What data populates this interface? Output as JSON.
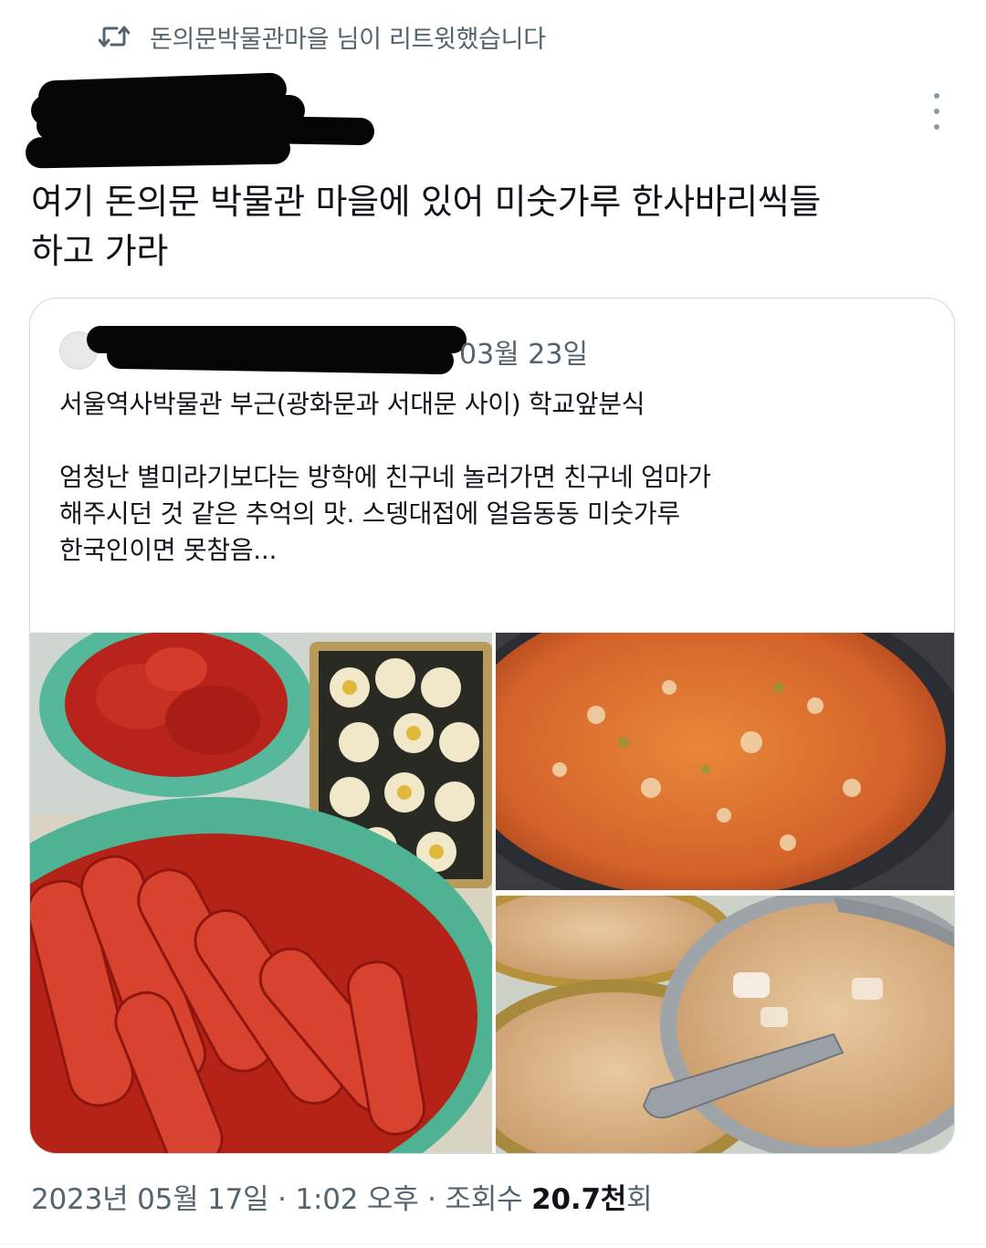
{
  "retweet_banner": {
    "text": "돈의문박물관마을 님이 리트윗했습니다"
  },
  "tweet": {
    "text": "여기 돈의문 박물관 마을에 있어 미숫가루 한사바리씩들\n하고 가라"
  },
  "quoted_tweet": {
    "date": "03월 23일",
    "text": "서울역사박물관 부근(광화문과 서대문 사이) 학교앞분식\n\n엄청난 별미라기보다는 방학에 친구네 놀러가면 친구네 엄마가\n해주시던 것 같은 추억의 맛. 스뎅대접에 얼음동동 미숫가루\n한국인이면 못참음..."
  },
  "meta": {
    "date": "2023년 05월 17일",
    "sep1": " · ",
    "time": "1:02 오후",
    "sep2": " · ",
    "views_label": "조회수 ",
    "views_value": "20.7천",
    "views_suffix": "회"
  },
  "icons": {
    "retweet": "retweet-icon",
    "more": "more-vertical-icon"
  },
  "colors": {
    "secondary_text": "#536471",
    "border": "#cfd9de",
    "text": "#0f1419"
  }
}
